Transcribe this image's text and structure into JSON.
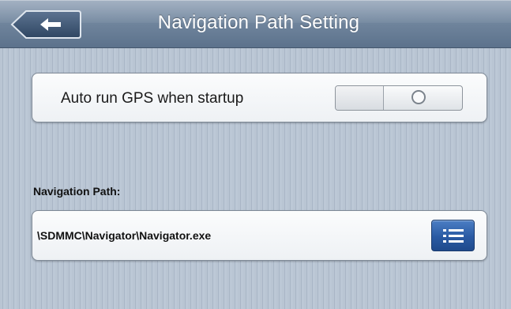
{
  "header": {
    "title": "Navigation Path Setting",
    "back_icon": "back-arrow-icon"
  },
  "gps_setting": {
    "label": "Auto run GPS when startup",
    "toggle_state": "off",
    "toggle_icon": "circle-off-icon"
  },
  "navigation_path": {
    "heading": "Navigation Path:",
    "value": "\\SDMMC\\Navigator\\Navigator.exe",
    "browse_icon": "list-icon"
  },
  "colors": {
    "header_bar": "#6f849c",
    "browse_button": "#2a5aa3",
    "background": "#b3c0cf"
  }
}
